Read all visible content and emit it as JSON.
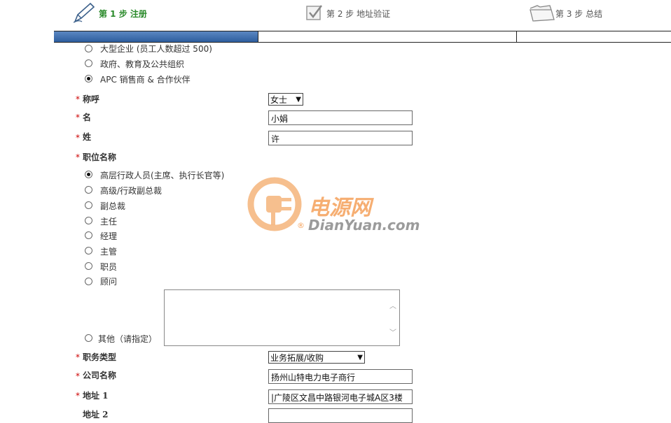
{
  "steps": [
    {
      "label": "第 1 步 注册",
      "icon": "pen-icon",
      "active": true
    },
    {
      "label": "第 2 步 地址验证",
      "icon": "checkbox-icon",
      "active": false
    },
    {
      "label": "第 3 步 总结",
      "icon": "folder-icon",
      "active": false
    }
  ],
  "progress": {
    "fraction": 0.33,
    "color": "#2d5e9e"
  },
  "org_type_options": [
    {
      "label": "大型企业 (员工人数超过 500)",
      "selected": false
    },
    {
      "label": "政府、教育及公共组织",
      "selected": false
    },
    {
      "label": "APC 销售商 & 合作伙伴",
      "selected": true
    }
  ],
  "fields": {
    "salutation": {
      "label": "称呼",
      "value": "女士"
    },
    "first_name": {
      "label": "名",
      "value": "小娟"
    },
    "last_name": {
      "label": "姓",
      "value": "许"
    },
    "job_title": {
      "label": "职位名称"
    },
    "job_type": {
      "label": "职务类型",
      "value": "业务拓展/收购"
    },
    "company": {
      "label": "公司名称",
      "value": "扬州山特电力电子商行"
    },
    "address1": {
      "label": "地址 1",
      "value": "|广陵区文昌中路银河电子城A区3楼"
    },
    "address2": {
      "label": "地址 2",
      "value": ""
    }
  },
  "job_title_options": [
    {
      "label": "高层行政人员(主席、执行长官等)",
      "selected": true
    },
    {
      "label": "高级/行政副总裁",
      "selected": false
    },
    {
      "label": "副总裁",
      "selected": false
    },
    {
      "label": "主任",
      "selected": false
    },
    {
      "label": "经理",
      "selected": false
    },
    {
      "label": "主管",
      "selected": false
    },
    {
      "label": "职员",
      "selected": false
    },
    {
      "label": "顾问",
      "selected": false
    },
    {
      "label": "其他（请指定）",
      "selected": false
    }
  ],
  "required_mark": "*",
  "watermark": {
    "cn": "电源网",
    "en": "DianYuan.com",
    "reg": "®",
    "color_orange": "#f5a15a",
    "color_gray": "#8a8a8a"
  }
}
